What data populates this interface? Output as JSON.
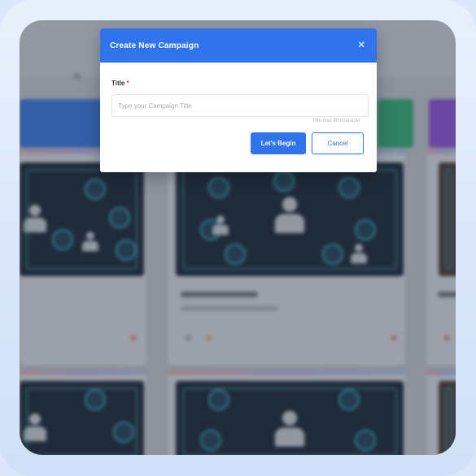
{
  "modal": {
    "title": "Create New Campaign",
    "close_symbol": "×",
    "field_label": "Title",
    "required_mark": "*",
    "input_placeholder": "Type your Campaign Title",
    "input_value": "",
    "hint": "Title max 80 character",
    "primary_button": "Let's Begin",
    "cancel_button": "Cancel"
  },
  "icons": {
    "close": "close-icon"
  },
  "colors": {
    "accent": "#2f74ea",
    "required": "#e04848"
  }
}
